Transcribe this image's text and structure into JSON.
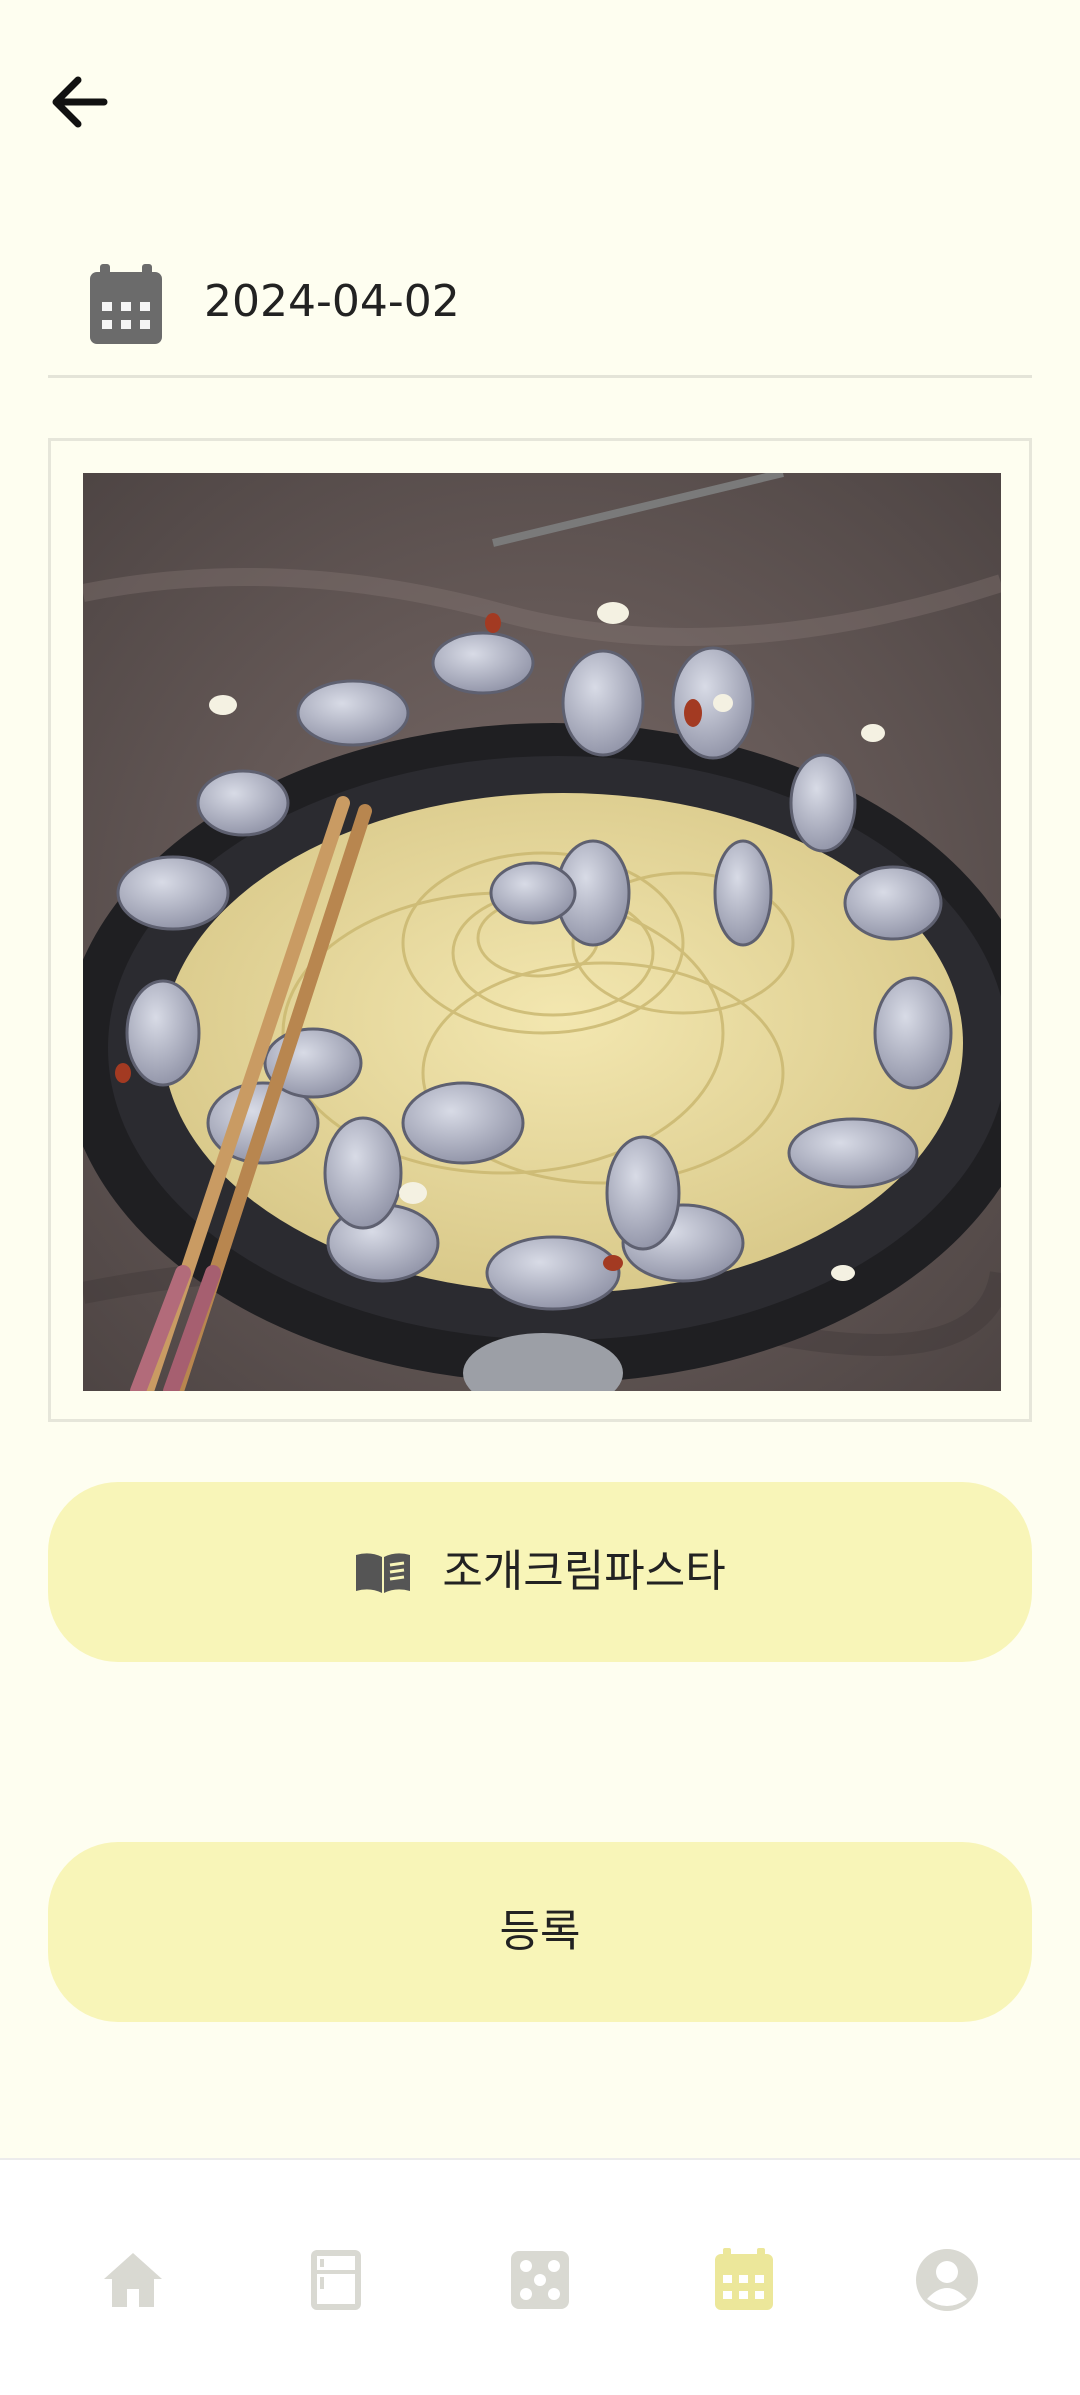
{
  "header": {
    "back_icon": "arrow-left-icon"
  },
  "date": {
    "icon": "calendar-icon",
    "value": "2024-04-02"
  },
  "photo": {
    "subject": "clam spaghetti in a pan"
  },
  "recipe_button": {
    "icon": "book-icon",
    "label": "조개크림파스타"
  },
  "submit_button": {
    "label": "등록"
  },
  "bottom_nav": {
    "items": [
      {
        "icon": "home-icon",
        "active": false
      },
      {
        "icon": "fridge-icon",
        "active": false
      },
      {
        "icon": "dice-icon",
        "active": false
      },
      {
        "icon": "calendar-icon",
        "active": true
      },
      {
        "icon": "user-icon",
        "active": false
      }
    ]
  },
  "colors": {
    "background": "#fefef0",
    "button": "#f8f5b8",
    "nav_inactive": "#d9d9d2",
    "nav_active": "#ece79a",
    "text": "#222222"
  }
}
